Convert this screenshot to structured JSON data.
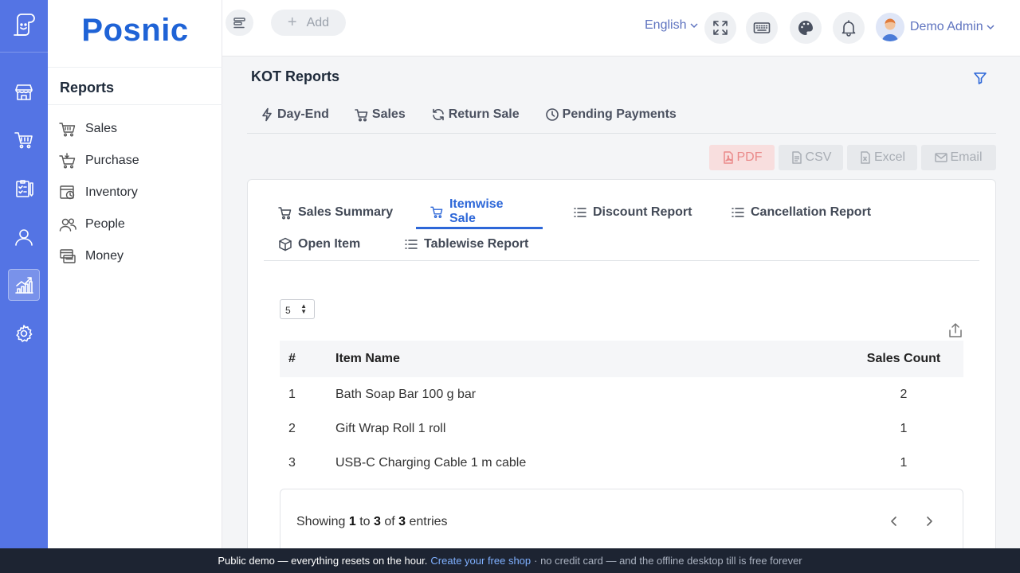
{
  "brand": {
    "name": "Posnic"
  },
  "sidebar": {
    "title": "Reports",
    "items": [
      {
        "label": "Sales",
        "icon": "basket-icon"
      },
      {
        "label": "Purchase",
        "icon": "cart-icon"
      },
      {
        "label": "Inventory",
        "icon": "inventory-icon"
      },
      {
        "label": "People",
        "icon": "people-icon"
      },
      {
        "label": "Money",
        "icon": "money-icon"
      }
    ]
  },
  "rail": {
    "items": [
      "store-icon",
      "cart-icon",
      "clipboard-icon",
      "user-icon",
      "chart-icon",
      "gear-icon"
    ],
    "active": "chart-icon"
  },
  "header": {
    "add_label": "Add",
    "language": "English",
    "user_name": "Demo Admin"
  },
  "page": {
    "title": "KOT Reports",
    "report_tabs": [
      {
        "label": "Day-End",
        "icon": "bolt-icon"
      },
      {
        "label": "Sales",
        "icon": "cart-icon"
      },
      {
        "label": "Return Sale",
        "icon": "refresh-icon"
      },
      {
        "label": "Pending Payments",
        "icon": "clock-icon"
      }
    ],
    "exports": {
      "pdf": "PDF",
      "csv": "CSV",
      "excel": "Excel",
      "email": "Email"
    }
  },
  "card": {
    "tabs": [
      {
        "label": "Sales Summary",
        "icon": "cart-icon"
      },
      {
        "label": "Itemwise Sale",
        "icon": "cart-icon",
        "active": true
      },
      {
        "label": "Discount Report",
        "icon": "list-icon"
      },
      {
        "label": "Cancellation Report",
        "icon": "list-icon"
      },
      {
        "label": "Open Item",
        "icon": "box-icon"
      },
      {
        "label": "Tablewise Report",
        "icon": "list-icon"
      }
    ],
    "page_size": "5",
    "table": {
      "headers": [
        "#",
        "Item Name",
        "Sales Count"
      ],
      "rows": [
        {
          "num": "1",
          "name": "Bath Soap Bar 100 g bar",
          "count": "2"
        },
        {
          "num": "2",
          "name": "Gift Wrap Roll 1 roll",
          "count": "1"
        },
        {
          "num": "3",
          "name": "USB-C Charging Cable 1 m cable",
          "count": "1"
        }
      ]
    },
    "info": {
      "prefix": "Showing",
      "from": "1",
      "to_word": "to",
      "to": "3",
      "of_word": "of",
      "total": "3",
      "suffix": "entries"
    }
  },
  "banner": {
    "text": "Public demo — everything resets on the hour.",
    "link": "Create your free shop",
    "tail": "· no credit card — and the offline desktop till is free forever"
  },
  "colors": {
    "accent": "#1f63d6",
    "rail": "#5474e4",
    "active_tab": "#2d67d8",
    "banner_bg": "#1d2432"
  }
}
